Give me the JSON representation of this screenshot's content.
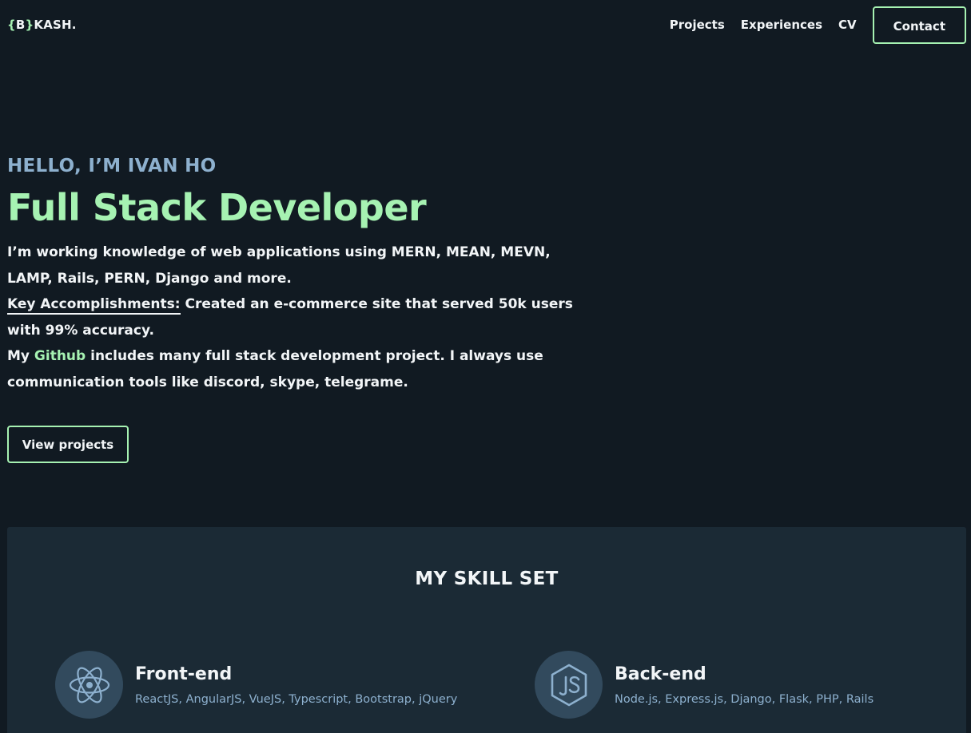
{
  "header": {
    "logo_brace_open": "{",
    "logo_letter": "B",
    "logo_brace_close": "}",
    "logo_text": "KASH.",
    "nav": [
      {
        "label": "Projects"
      },
      {
        "label": "Experiences"
      },
      {
        "label": "CV"
      }
    ],
    "contact_label": "Contact"
  },
  "hero": {
    "greeting": "HELLO, I’M IVAN HO",
    "title": "Full Stack Developer",
    "line1": "I’m working knowledge of web applications using MERN, MEAN, MEVN, LAMP, Rails, PERN, Django and more.",
    "key_label": "Key Accomplishments:",
    "key_text": " Created an e-commerce site that served 50k users with 99% accuracy.",
    "github_prefix": "My ",
    "github_link": "Github",
    "github_suffix": " includes many full stack development project. I always use communication tools like discord, skype, telegrame.",
    "button_label": "View projects"
  },
  "skills": {
    "title": "MY SKILL SET",
    "items": [
      {
        "name": "Front-end",
        "list": "ReactJS, AngularJS, VueJS, Typescript, Bootstrap, jQuery",
        "icon": "react-icon"
      },
      {
        "name": "Back-end",
        "list": "Node.js, Express.js, Django, Flask, PHP, Rails",
        "icon": "nodejs-icon"
      }
    ]
  },
  "colors": {
    "background": "#111a22",
    "accent": "#a6f2b2",
    "muted_blue": "#8db0ce",
    "panel": "#1b2a35",
    "icon_circle": "#324a5d"
  }
}
